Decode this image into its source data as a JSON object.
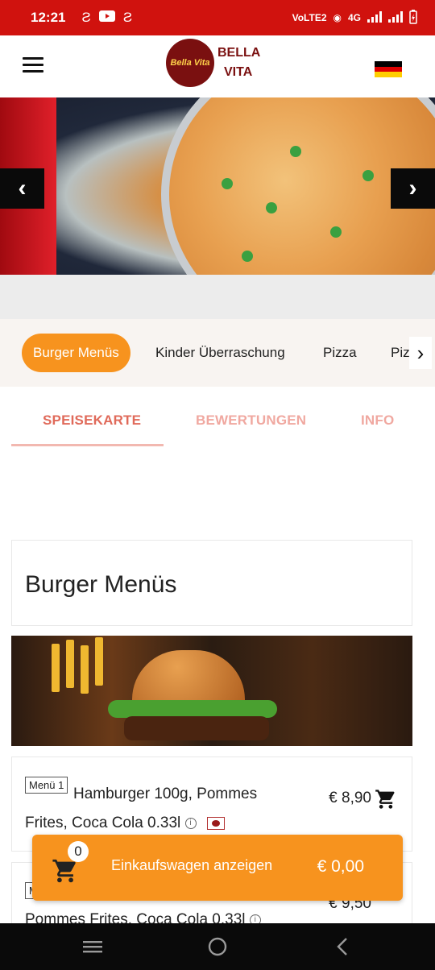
{
  "status_bar": {
    "time": "12:21",
    "network_label": "4G",
    "volte_label": "VoLTE2"
  },
  "app_bar": {
    "logo_circle_text": "Bella Vita",
    "logo_line1": "BELLA",
    "logo_line2": "VITA",
    "language_flag": "german-flag",
    "flag_colors": [
      "#000000",
      "#dd0000",
      "#ffce00"
    ]
  },
  "hero": {
    "prev_label": "‹",
    "next_label": "›"
  },
  "categories": {
    "items": [
      {
        "label": "Burger Menüs",
        "active": true
      },
      {
        "label": "Kinder Überraschung",
        "active": false
      },
      {
        "label": "Pizza",
        "active": false
      },
      {
        "label": "Piz",
        "active": false
      }
    ],
    "next_label": "›"
  },
  "tabs": [
    {
      "label": "SPEISEKARTE",
      "active": true
    },
    {
      "label": "BEWERTUNGEN",
      "active": false
    },
    {
      "label": "INFO",
      "active": false
    }
  ],
  "section": {
    "title": "Burger Menüs"
  },
  "items": [
    {
      "tag": "Menü 1",
      "name": "Hamburger 100g, Pommes Frites, Coca Cola 0.33l",
      "price": "€ 8,90"
    },
    {
      "tag": "M",
      "name_visible": "Pommes Frites, Coca Cola 0.33l",
      "price": "€ 9,50"
    }
  ],
  "cart": {
    "count": "0",
    "label": "Einkaufswagen anzeigen",
    "total": "€ 0,00"
  },
  "colors": {
    "status_bar": "#d0120e",
    "accent_orange": "#f7931e",
    "tab_active": "#e06a5a",
    "brand_dark_red": "#7a1010"
  }
}
